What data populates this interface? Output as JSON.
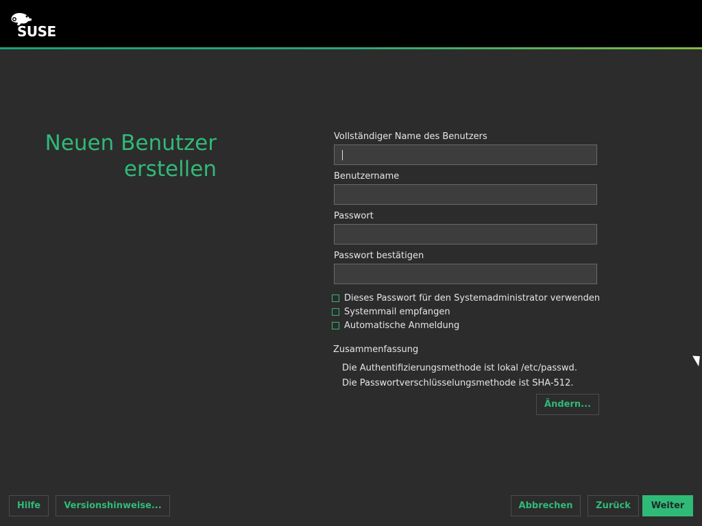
{
  "header": {
    "brand": "SUSE"
  },
  "page_title": {
    "line1": "Neuen Benutzer",
    "line2": "erstellen"
  },
  "form": {
    "full_name_label": "Vollständiger Name des Benutzers",
    "full_name_value": "",
    "username_label": "Benutzername",
    "username_value": "",
    "password_label": "Passwort",
    "password_value": "",
    "password_confirm_label": "Passwort bestätigen",
    "password_confirm_value": ""
  },
  "checkboxes": {
    "use_for_admin": {
      "label": "Dieses Passwort für den Systemadministrator verwenden",
      "checked": false
    },
    "system_mail": {
      "label": "Systemmail empfangen",
      "checked": false
    },
    "auto_login": {
      "label": "Automatische Anmeldung",
      "checked": false
    }
  },
  "summary": {
    "title": "Zusammenfassung",
    "line1": "Die Authentifizierungsmethode ist lokal /etc/passwd.",
    "line2": "Die Passwortverschlüsselungsmethode ist SHA-512.",
    "change_button": "Ändern..."
  },
  "footer": {
    "help": "Hilfe",
    "release_notes": "Versionshinweise...",
    "abort": "Abbrechen",
    "back": "Zurück",
    "next": "Weiter"
  },
  "colors": {
    "accent": "#30ba78",
    "background": "#2c2c2c",
    "topbar": "#000000"
  }
}
